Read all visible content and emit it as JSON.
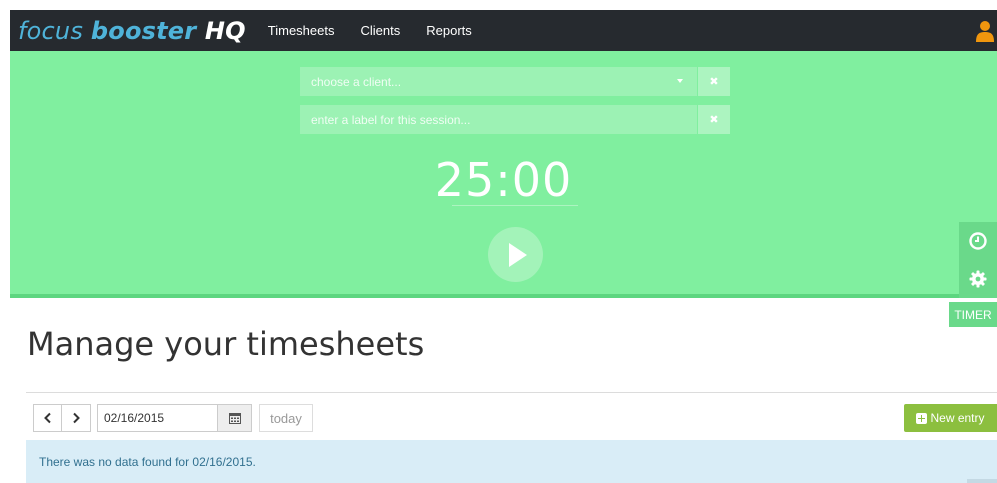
{
  "navbar": {
    "logo": {
      "part1": "focus ",
      "part2": "booster",
      "part3": " HQ"
    },
    "links": [
      "Timesheets",
      "Clients",
      "Reports"
    ],
    "user_icon": "user-icon"
  },
  "timer": {
    "client_placeholder": "choose a client...",
    "label_placeholder": "enter a label for this session...",
    "clear_symbol": "✖",
    "time": "25:00",
    "tab_label": "TIMER",
    "icons": [
      "play-icon",
      "clock-icon",
      "gear-icon"
    ]
  },
  "content": {
    "title": "Manage your timesheets",
    "date_value": "02/16/2015",
    "today_label": "today",
    "new_entry_label": "New entry",
    "alert": "There was no data found for 02/16/2015."
  },
  "colors": {
    "navbar": "#262a2f",
    "timer_bg": "#80ef9f",
    "accent_blue": "#4fb3d9",
    "user_orange": "#f0960e",
    "new_entry_green": "#8cbf3f",
    "alert_bg": "#d9edf7"
  }
}
